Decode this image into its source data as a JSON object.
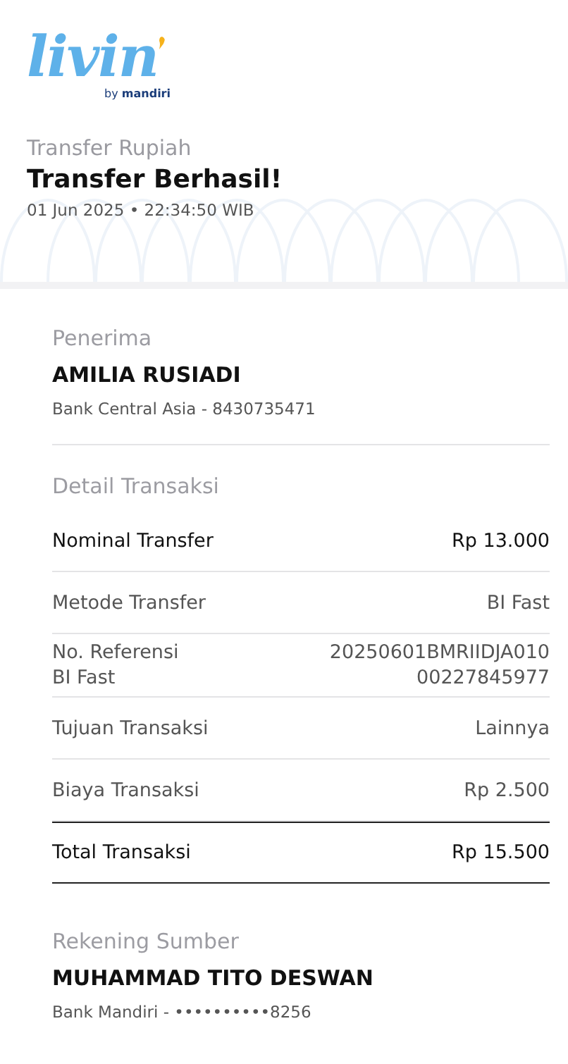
{
  "logo": {
    "word": "livin",
    "tagline_prefix": "by",
    "tagline_brand": "mandiri"
  },
  "header": {
    "category": "Transfer Rupiah",
    "title": "Transfer Berhasil!",
    "timestamp": "01 Jun 2025 • 22:34:50 WIB"
  },
  "recipient": {
    "heading": "Penerima",
    "name": "AMILIA RUSIADI",
    "account": "Bank Central Asia - 8430735471"
  },
  "details": {
    "heading": "Detail Transaksi",
    "rows": [
      {
        "kind": "strong",
        "label": "Nominal Transfer",
        "value": "Rp 13.000"
      },
      {
        "kind": "plain",
        "label": "Metode Transfer",
        "value": "BI Fast"
      },
      {
        "kind": "plain",
        "label": "No. Referensi\nBI Fast",
        "value": "20250601BMRIIDJA010\n00227845977"
      },
      {
        "kind": "plain",
        "label": "Tujuan Transaksi",
        "value": "Lainnya"
      },
      {
        "kind": "plain",
        "label": "Biaya Transaksi",
        "value": "Rp 2.500"
      },
      {
        "kind": "total",
        "label": "Total Transaksi",
        "value": "Rp 15.500"
      }
    ]
  },
  "source": {
    "heading": "Rekening Sumber",
    "name": "MUHAMMAD TITO DESWAN",
    "account": "Bank Mandiri - ••••••••••8256"
  }
}
